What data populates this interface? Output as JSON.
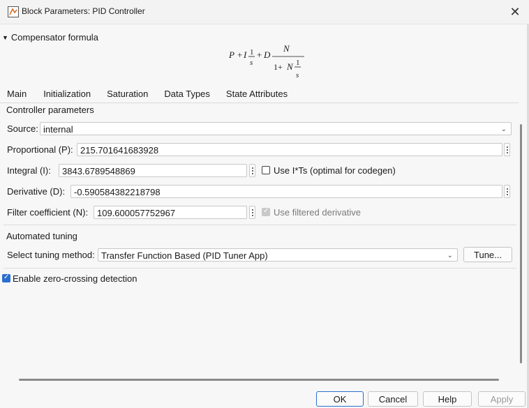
{
  "window": {
    "title": "Block Parameters: PID Controller",
    "close_symbol": "✕"
  },
  "compensator": {
    "header": "Compensator formula",
    "formula": {
      "P": "P",
      "plus": "+",
      "I": "I",
      "one": "1",
      "s": "s",
      "D": "D",
      "N": "N",
      "denom_prefix": "1+",
      "denom_N": "N"
    }
  },
  "tabs": [
    {
      "label": "Main"
    },
    {
      "label": "Initialization"
    },
    {
      "label": "Saturation"
    },
    {
      "label": "Data Types"
    },
    {
      "label": "State Attributes"
    }
  ],
  "controller": {
    "group_label": "Controller parameters",
    "source_label": "Source:",
    "source_value": "internal",
    "p_label": "Proportional (P):",
    "p_value": "215.701641683928",
    "i_label": "Integral (I):",
    "i_value": "3843.6789548869",
    "use_its_label": "Use I*Ts (optimal for codegen)",
    "d_label": "Derivative (D):",
    "d_value": "-0.590584382218798",
    "n_label": "Filter coefficient (N):",
    "n_value": "109.600057752967",
    "use_filtered_label": "Use filtered derivative"
  },
  "tuning": {
    "group_label": "Automated tuning",
    "method_label": "Select tuning method:",
    "method_value": "Transfer Function Based (PID Tuner App)",
    "tune_button": "Tune..."
  },
  "zero_crossing": {
    "label": "Enable zero-crossing detection",
    "checked": true
  },
  "footer": {
    "ok": "OK",
    "cancel": "Cancel",
    "help": "Help",
    "apply": "Apply"
  },
  "colors": {
    "accent": "#2a6fcf",
    "background": "#f3f3f3"
  }
}
